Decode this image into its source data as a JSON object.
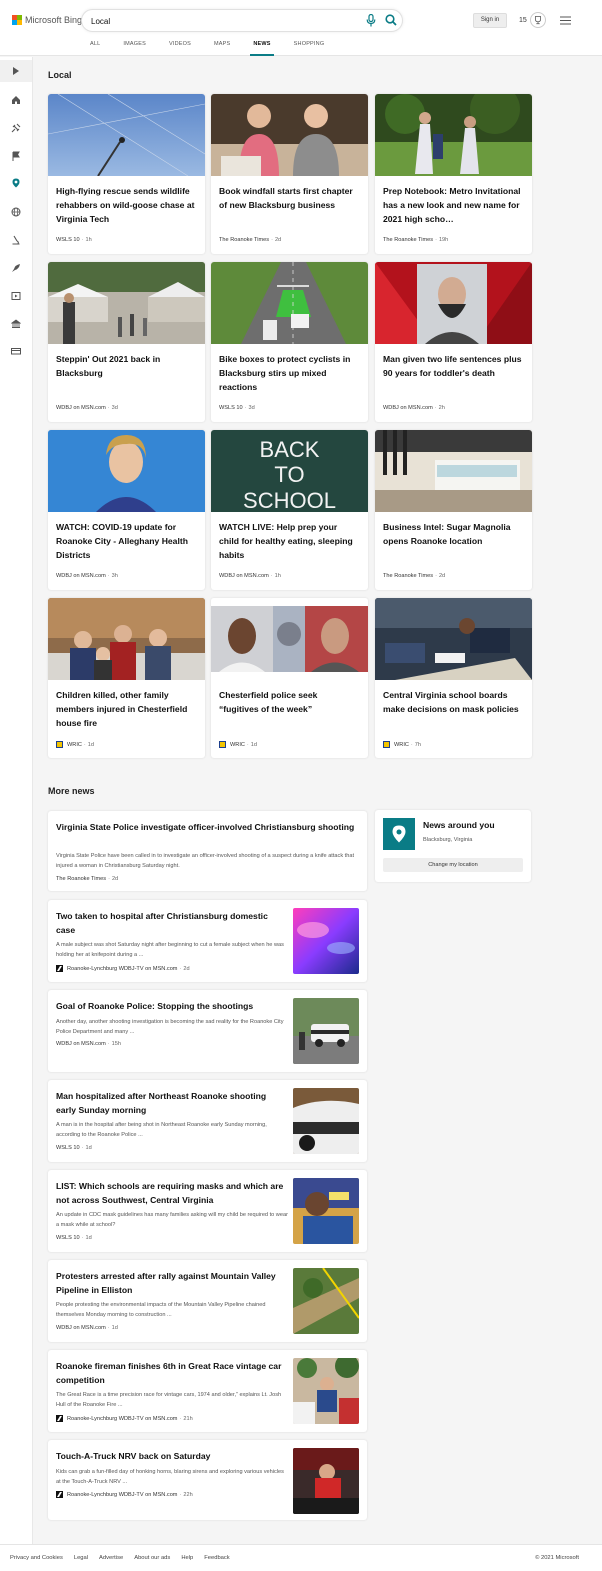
{
  "header": {
    "logo_text": "Microsoft Bing",
    "search_value": "Local",
    "sign_in": "Sign in",
    "points": "15",
    "scopes": [
      "ALL",
      "IMAGES",
      "VIDEOS",
      "MAPS",
      "NEWS",
      "SHOPPING"
    ],
    "active_scope": "NEWS"
  },
  "colors": {
    "accent": "#0a7c86"
  },
  "rail": {
    "icons": [
      "chevron-right-icon",
      "home-icon",
      "satellite-icon",
      "flag-icon",
      "location-pin-icon",
      "globe-icon",
      "microscope-icon",
      "rocket-icon",
      "play-icon",
      "bank-icon",
      "money-icon"
    ]
  },
  "local": {
    "title": "Local",
    "cards": [
      {
        "title": "High-flying rescue sends wildlife rehabbers on wild-goose chase at Virginia Tech",
        "source": "WSLS 10",
        "ago": "1h"
      },
      {
        "title": "Book windfall starts first chapter of new Blacksburg business",
        "source": "The Roanoke Times",
        "ago": "2d"
      },
      {
        "title": "Prep Notebook: Metro Invitational has a new look and new name for 2021 high scho…",
        "source": "The Roanoke Times",
        "ago": "19h"
      },
      {
        "title": "Steppin' Out 2021 back in Blacksburg",
        "source": "WDBJ on MSN.com",
        "ago": "3d"
      },
      {
        "title": "Bike boxes to protect cyclists in Blacksburg stirs up mixed reactions",
        "source": "WSLS 10",
        "ago": "3d"
      },
      {
        "title": "Man given two life sentences plus 90 years for toddler's death",
        "source": "WDBJ on MSN.com",
        "ago": "2h"
      },
      {
        "title": "WATCH: COVID-19 update for Roanoke City - Alleghany Health Districts",
        "source": "WDBJ on MSN.com",
        "ago": "3h"
      },
      {
        "title": "WATCH LIVE: Help prep your child for healthy eating, sleeping habits",
        "source": "WDBJ on MSN.com",
        "ago": "1h"
      },
      {
        "title": "Business Intel: Sugar Magnolia opens Roanoke location",
        "source": "The Roanoke Times",
        "ago": "2d"
      },
      {
        "title": "Children killed, other family members injured in Chesterfield house fire",
        "source": "WRIC",
        "ago": "1d"
      },
      {
        "title": "Chesterfield police seek “fugitives of the week”",
        "source": "WRIC",
        "ago": "1d"
      },
      {
        "title": "Central Virginia school boards make decisions on mask policies",
        "source": "WRIC",
        "ago": "7h"
      }
    ],
    "chalkboard_text": [
      "BACK",
      "TO",
      "SCHOOL"
    ]
  },
  "more": {
    "title": "More news",
    "items": [
      {
        "title": "Virginia State Police investigate officer-involved Christiansburg shooting",
        "snippet": "Virginia State Police have been called in to investigate an officer-involved shooting of a suspect during a knife attack that injured a woman in Christiansburg Saturday night.",
        "source": "The Roanoke Times",
        "ago": "2d"
      },
      {
        "title": "Two taken to hospital after Christiansburg domestic case",
        "snippet": "A male subject was shot Saturday night after beginning to cut a female subject when he was holding her at knifepoint during a ...",
        "source": "Roanoke-Lynchburg WDBJ-TV on MSN.com",
        "ago": "2d"
      },
      {
        "title": "Goal of Roanoke Police: Stopping the shootings",
        "snippet": "Another day, another shooting investigation is becoming the sad reality for the Roanoke City Police Department and many ...",
        "source": "WDBJ on MSN.com",
        "ago": "15h"
      },
      {
        "title": "Man hospitalized after Northeast Roanoke shooting early Sunday morning",
        "snippet": "A man is in the hospital after being shot in Northeast Roanoke early Sunday morning, according to the Roanoke Police ...",
        "source": "WSLS 10",
        "ago": "1d"
      },
      {
        "title": "LIST: Which schools are requiring masks and which are not across Southwest, Central Virginia",
        "snippet": "An update in CDC mask guidelines has many families asking will my child be required to wear a mask while at school?",
        "source": "WSLS 10",
        "ago": "1d"
      },
      {
        "title": "Protesters arrested after rally against Mountain Valley Pipeline in Elliston",
        "snippet": "People protesting the environmental impacts of the Mountain Valley Pipeline chained themselves Monday morning to construction ...",
        "source": "WDBJ on MSN.com",
        "ago": "1d"
      },
      {
        "title": "Roanoke fireman finishes 6th in Great Race vintage car competition",
        "snippet": "The Great Race is a time precision race for vintage cars, 1974 and older,” explains Lt. Josh Hull of the Roanoke Fire ...",
        "source": "Roanoke-Lynchburg WDBJ-TV on MSN.com",
        "ago": "21h"
      },
      {
        "title": "Touch-A-Truck NRV back on Saturday",
        "snippet": "Kids can grab a fun-filled day of honking horns, blaring sirens and exploring various vehicles at the Touch-A-Truck NRV ...",
        "source": "Roanoke-Lynchburg WDBJ-TV on MSN.com",
        "ago": "22h"
      }
    ]
  },
  "location": {
    "title": "News around you",
    "place": "Blacksburg, Virginia",
    "button": "Change my location"
  },
  "footer": {
    "links": [
      "Privacy and Cookies",
      "Legal",
      "Advertise",
      "About our ads",
      "Help",
      "Feedback"
    ],
    "copyright": "© 2021 Microsoft"
  }
}
